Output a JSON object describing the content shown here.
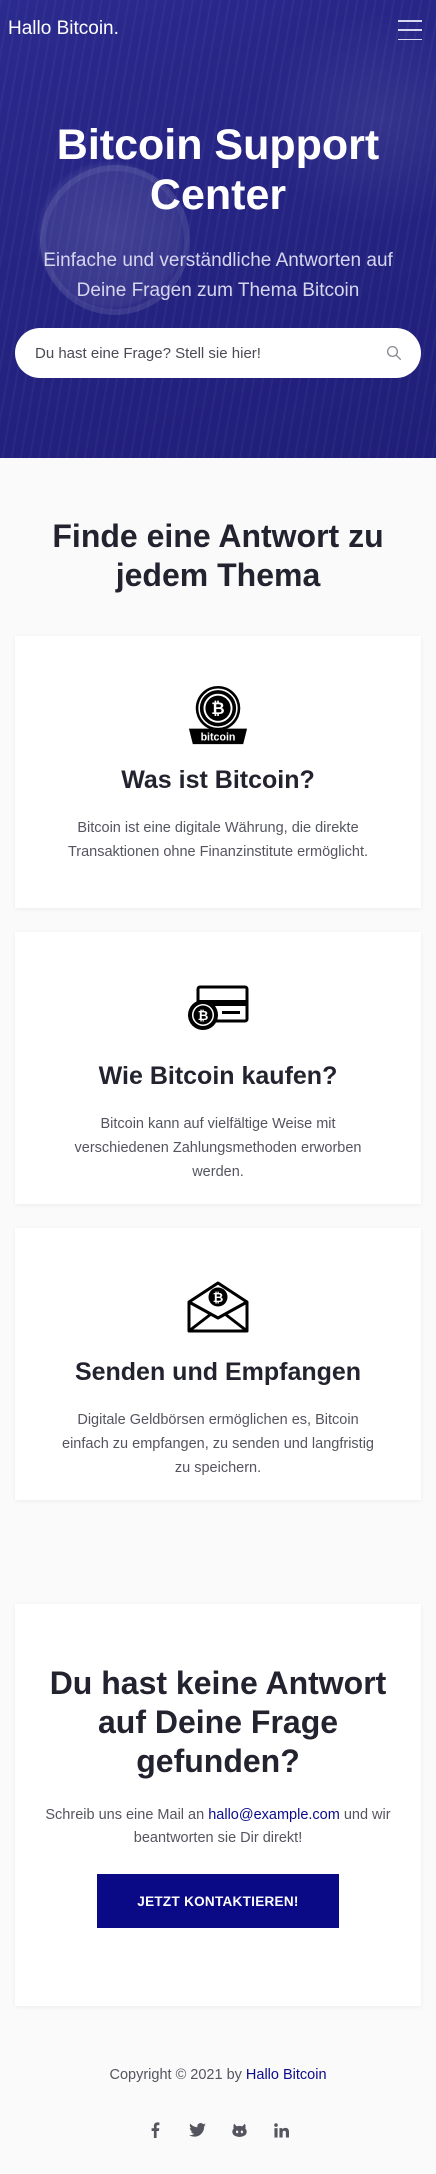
{
  "header": {
    "brand": "Hallo Bitcoin.",
    "menu_icon": "hamburger-menu-icon"
  },
  "hero": {
    "title": "Bitcoin Support Center",
    "subtitle": "Einfache und verständliche Antworten auf Deine Fragen zum Thema Bitcoin",
    "search_placeholder": "Du hast eine Frage? Stell sie hier!",
    "search_icon": "search-icon"
  },
  "topics": {
    "heading": "Finde eine Antwort zu jedem Thema",
    "cards": [
      {
        "icon": "bitcoin-logo-icon",
        "icon_text": "bitcoin",
        "title": "Was ist Bitcoin?",
        "text": "Bitcoin ist eine digitale Währung, die direkte Transaktionen ohne Finanzinstitute ermöglicht."
      },
      {
        "icon": "bitcoin-card-icon",
        "title": "Wie Bitcoin kaufen?",
        "text": "Bitcoin kann auf vielfältige Weise mit verschiedenen Zahlungsmethoden erworben werden."
      },
      {
        "icon": "bitcoin-envelope-icon",
        "title": "Senden und Empfangen",
        "text": "Digitale Geldbörsen ermöglichen es, Bitcoin einfach zu empfangen, zu senden und langfristig zu speichern."
      }
    ]
  },
  "contact": {
    "heading": "Du hast keine Antwort auf Deine Frage gefunden?",
    "text_before": "Schreib uns eine Mail an ",
    "email": "hallo@example.com",
    "text_after": " und wir beantworten sie Dir direkt!",
    "button_label": "JETZT KONTAKTIEREN!"
  },
  "footer": {
    "copyright_prefix": "Copyright © 2021 by ",
    "copyright_link": "Hallo Bitcoin",
    "socials": [
      "facebook-icon",
      "twitter-icon",
      "github-icon",
      "linkedin-icon"
    ]
  },
  "colors": {
    "hero_bg": "#262584",
    "accent": "#0a0a86",
    "text": "#23232f",
    "muted": "#55555f"
  }
}
